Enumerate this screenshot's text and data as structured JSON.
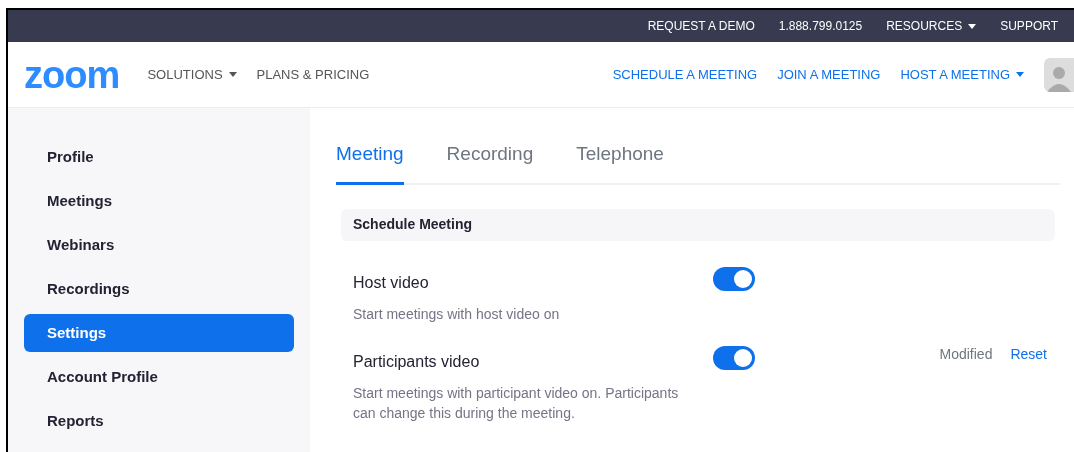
{
  "top_bar": {
    "links": [
      {
        "label": "REQUEST A DEMO",
        "caret": false
      },
      {
        "label": "1.888.799.0125",
        "caret": false
      },
      {
        "label": "RESOURCES",
        "caret": true
      },
      {
        "label": "SUPPORT",
        "caret": false
      }
    ]
  },
  "header": {
    "logo": "zoom",
    "left_nav": [
      {
        "label": "SOLUTIONS",
        "caret": true
      },
      {
        "label": "PLANS & PRICING",
        "caret": false
      }
    ],
    "right_nav": [
      {
        "label": "SCHEDULE A MEETING",
        "caret": false
      },
      {
        "label": "JOIN A MEETING",
        "caret": false
      },
      {
        "label": "HOST A MEETING",
        "caret": true
      }
    ]
  },
  "sidebar": {
    "items": [
      {
        "label": "Profile",
        "selected": false
      },
      {
        "label": "Meetings",
        "selected": false
      },
      {
        "label": "Webinars",
        "selected": false
      },
      {
        "label": "Recordings",
        "selected": false
      },
      {
        "label": "Settings",
        "selected": true
      },
      {
        "label": "Account Profile",
        "selected": false
      },
      {
        "label": "Reports",
        "selected": false
      }
    ]
  },
  "tabs": [
    {
      "label": "Meeting",
      "selected": true
    },
    {
      "label": "Recording",
      "selected": false
    },
    {
      "label": "Telephone",
      "selected": false
    }
  ],
  "section": {
    "title": "Schedule Meeting"
  },
  "settings": [
    {
      "title": "Host video",
      "description": "Start meetings with host video on",
      "on": true
    },
    {
      "title": "Participants video",
      "description": "Start meetings with participant video on. Participants can change this during the meeting.",
      "on": true,
      "modified_label": "Modified",
      "reset_label": "Reset"
    }
  ]
}
